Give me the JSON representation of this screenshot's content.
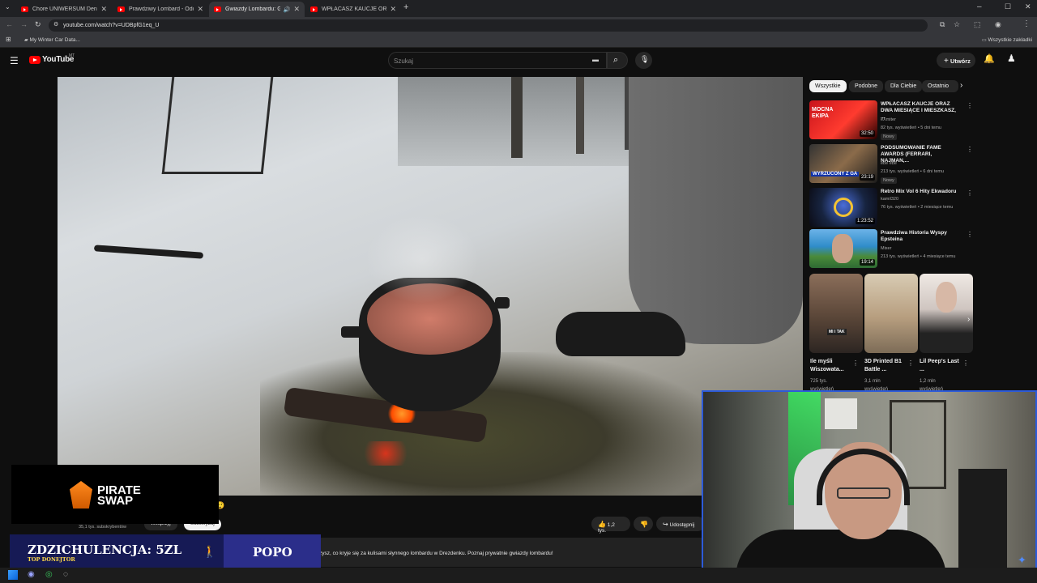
{
  "browser": {
    "tabs": [
      {
        "title": "Chore UNIWERSUM Denisa Za",
        "active": false
      },
      {
        "title": "Prawdziwy Lombard - Odcinek",
        "active": false
      },
      {
        "title": "Gwiazdy Lombardu: Gotuje",
        "active": true
      },
      {
        "title": "WPŁACASZ KAUCJE ORAZ DW",
        "active": false
      }
    ],
    "url": "youtube.com/watch?v=UDBpfG1eq_U",
    "bookmark": "My Winter Car Data...",
    "all_bookmarks": "Wszystkie zakładki"
  },
  "youtube": {
    "logo": "YouTube",
    "country": "MT",
    "search_placeholder": "Szukaj",
    "create_label": "Utwórz"
  },
  "chips": [
    "Wszystkie",
    "Podobne",
    "Dla Ciebie",
    "Ostatnio"
  ],
  "recommendations": [
    {
      "title": "WPŁACASZ KAUCJE ORAZ DWA MIESIĄCE I MIESZKASZ, ...",
      "channel": "eXmiter",
      "meta": "82 tys. wyświetleń • 5 dni temu",
      "badge": "Nowy",
      "duration": "32:50",
      "thumb_text": "MOCNA EKIPA"
    },
    {
      "title": "PODSUMOWANIE FAME AWARDS (FERRARI, NAJMAN,...",
      "channel": "ebe ebe",
      "meta": "213 tys. wyświetleń • 6 dni temu",
      "badge": "Nowy",
      "duration": "23:19",
      "thumb_text": "WYRZUCONY Z GA"
    },
    {
      "title": "Retro Mix Vol 6 Hity Ekwadoru",
      "channel": "kamil320",
      "meta": "76 tys. wyświetleń • 2 miesiące temu",
      "badge": "",
      "duration": "1:23:52",
      "thumb_text": ""
    },
    {
      "title": "Prawdziwa Historia Wyspy Epsteina",
      "channel": "Mixer",
      "meta": "213 tys. wyświetleń • 4 miesiące temu",
      "badge": "",
      "duration": "19:14",
      "thumb_text": ""
    }
  ],
  "shorts": [
    {
      "title": "Ile myśli Wiszowata...",
      "views": "725 tys. wyświetleń",
      "thumb_text": "MI I TAK"
    },
    {
      "title": "3D Printed B1 Battle ...",
      "views": "3,1 mln wyświetleń",
      "thumb_text": ""
    },
    {
      "title": "Lil Peep's Last ...",
      "views": "1,2 mln wyświetleń",
      "thumb_text": ""
    }
  ],
  "video_actions": {
    "likes": "1,2 tys.",
    "share": "Udostępnij",
    "subscribers": "35,1 tys. subskrybentów",
    "support": "Wesprzyj",
    "subscribe": "Subskrybuj"
  },
  "description": "ku zobaczysz, co kryje się za kulisami słynnego lombardu w Drezdenku. Poznaj prywatnie gwiazdy lombardu!",
  "overlays": {
    "sponsor_line1": "PIRATE",
    "sponsor_line2": "SWAP",
    "donation_title": "ZDZICHULENCJA: 5ZL",
    "donation_sub": "TOP DONEJTOR",
    "donation_right": "POPO"
  },
  "colors": {
    "yt_red": "#ff0000",
    "banner_blue": "#1b1f6b",
    "webcam_border": "#2d5bd9"
  }
}
